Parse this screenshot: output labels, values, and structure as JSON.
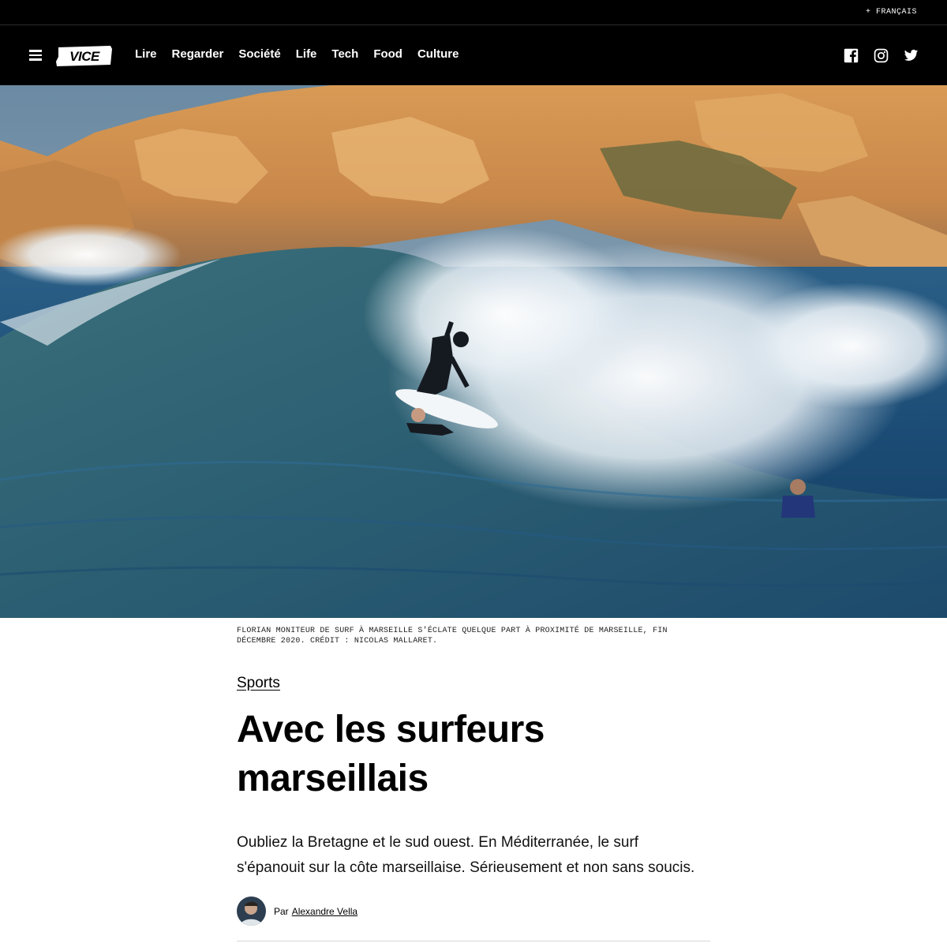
{
  "topbar": {
    "language_link": "+ FRANÇAIS"
  },
  "nav": {
    "logo_text": "VICE",
    "links": [
      "Lire",
      "Regarder",
      "Société",
      "Life",
      "Tech",
      "Food",
      "Culture"
    ]
  },
  "article": {
    "caption": "FLORIAN MONITEUR DE SURF À MARSEILLE S'ÉCLATE QUELQUE PART À PROXIMITÉ DE MARSEILLE, FIN DÉCEMBRE 2020. CRÉDIT : NICOLAS MALLARET.",
    "section": "Sports",
    "headline": "Avec les surfeurs marseillais",
    "dek": "Oubliez la Bretagne et le sud ouest. En Méditerranée, le surf s'épanouit sur la côte marseillaise. Sérieusement et non sans soucis.",
    "byline_prefix": "Par",
    "author": "Alexandre Vella"
  },
  "icons": {
    "menu": "hamburger-icon",
    "socials": [
      "facebook-icon",
      "instagram-icon",
      "twitter-icon"
    ]
  },
  "colors": {
    "nav_bg": "#000000",
    "text": "#000000",
    "page_bg": "#ffffff"
  }
}
